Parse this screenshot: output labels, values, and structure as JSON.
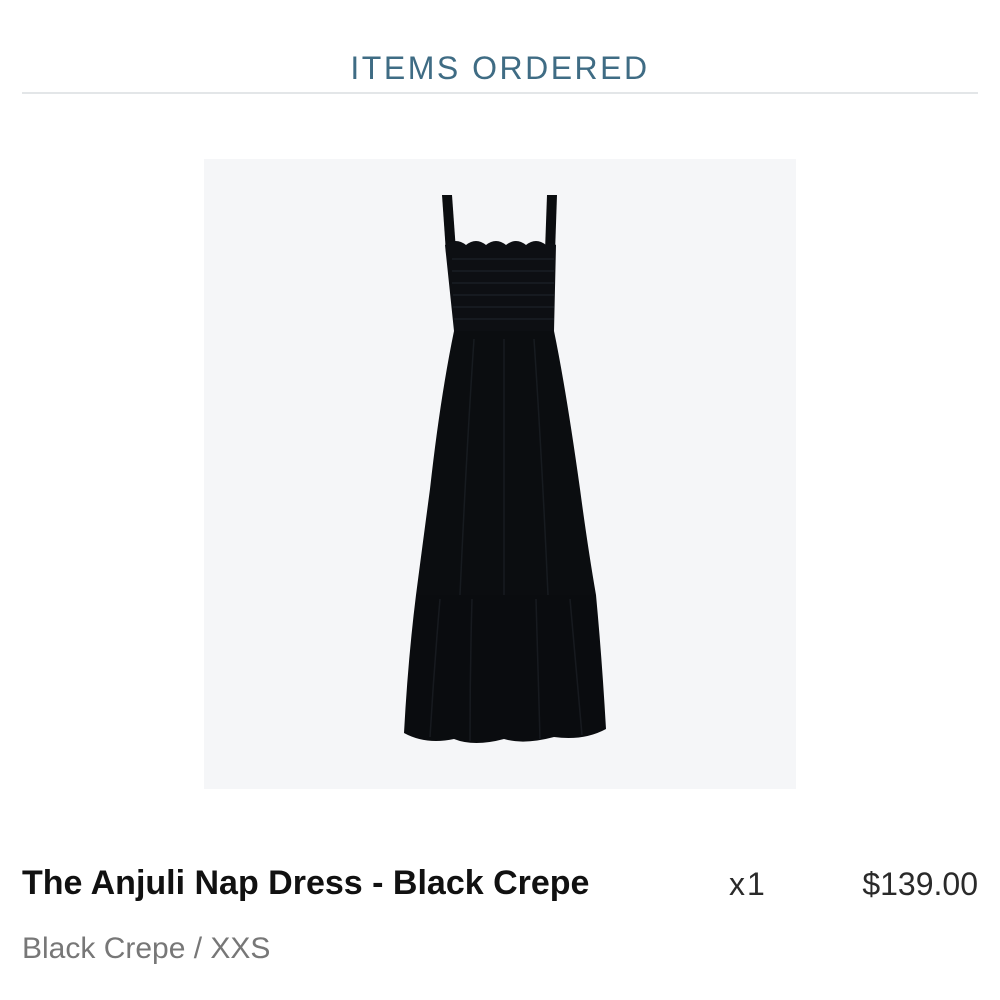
{
  "section": {
    "title": "ITEMS ORDERED"
  },
  "order_item": {
    "image_subject": "black-maxi-dress",
    "name": "The Anjuli Nap Dress - Black Crepe",
    "quantity": "x1",
    "price": "$139.00",
    "variant": "Black Crepe / XXS"
  },
  "colors": {
    "accent": "#3f6c84",
    "image_background": "#f5f6f8",
    "product": "#0b0d10"
  }
}
